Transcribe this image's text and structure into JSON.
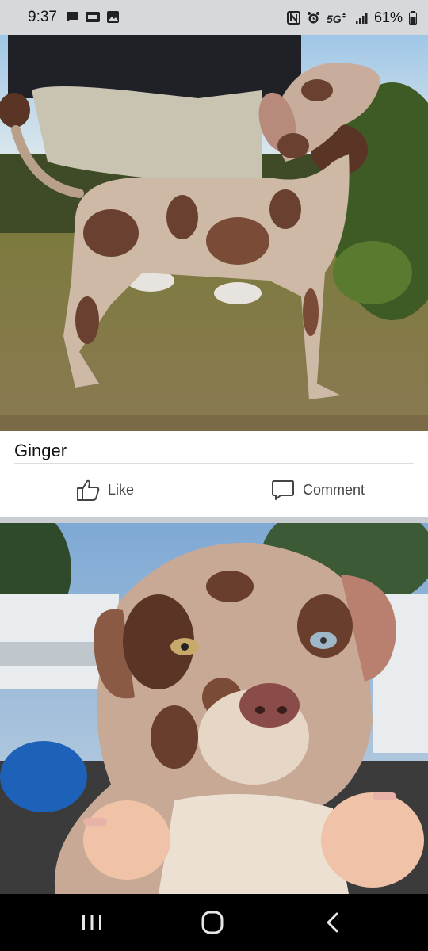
{
  "status_bar": {
    "time": "9:37",
    "left_icons": [
      "message-icon",
      "voicemail-icon",
      "gallery-icon"
    ],
    "right_icons": [
      "nfc-icon",
      "alarm-icon",
      "5g-signal-icon",
      "signal-bars-icon"
    ],
    "network": "5G",
    "battery_percent": "61%",
    "battery_level": 0.61
  },
  "posts": [
    {
      "photo_alt": "merle puppy standing on grass",
      "caption": "Ginger",
      "actions": {
        "like_label": "Like",
        "comment_label": "Comment"
      }
    },
    {
      "photo_alt": "close-up of merle puppy face"
    }
  ],
  "nav_bar": {
    "buttons": [
      "recents-icon",
      "home-icon",
      "back-icon"
    ]
  },
  "colors": {
    "status_bar_bg": "#d6d8dc",
    "card_bg": "#ffffff",
    "feed_bg": "#c9ccd1",
    "nav_bg": "#000000",
    "action_text": "#444444"
  }
}
